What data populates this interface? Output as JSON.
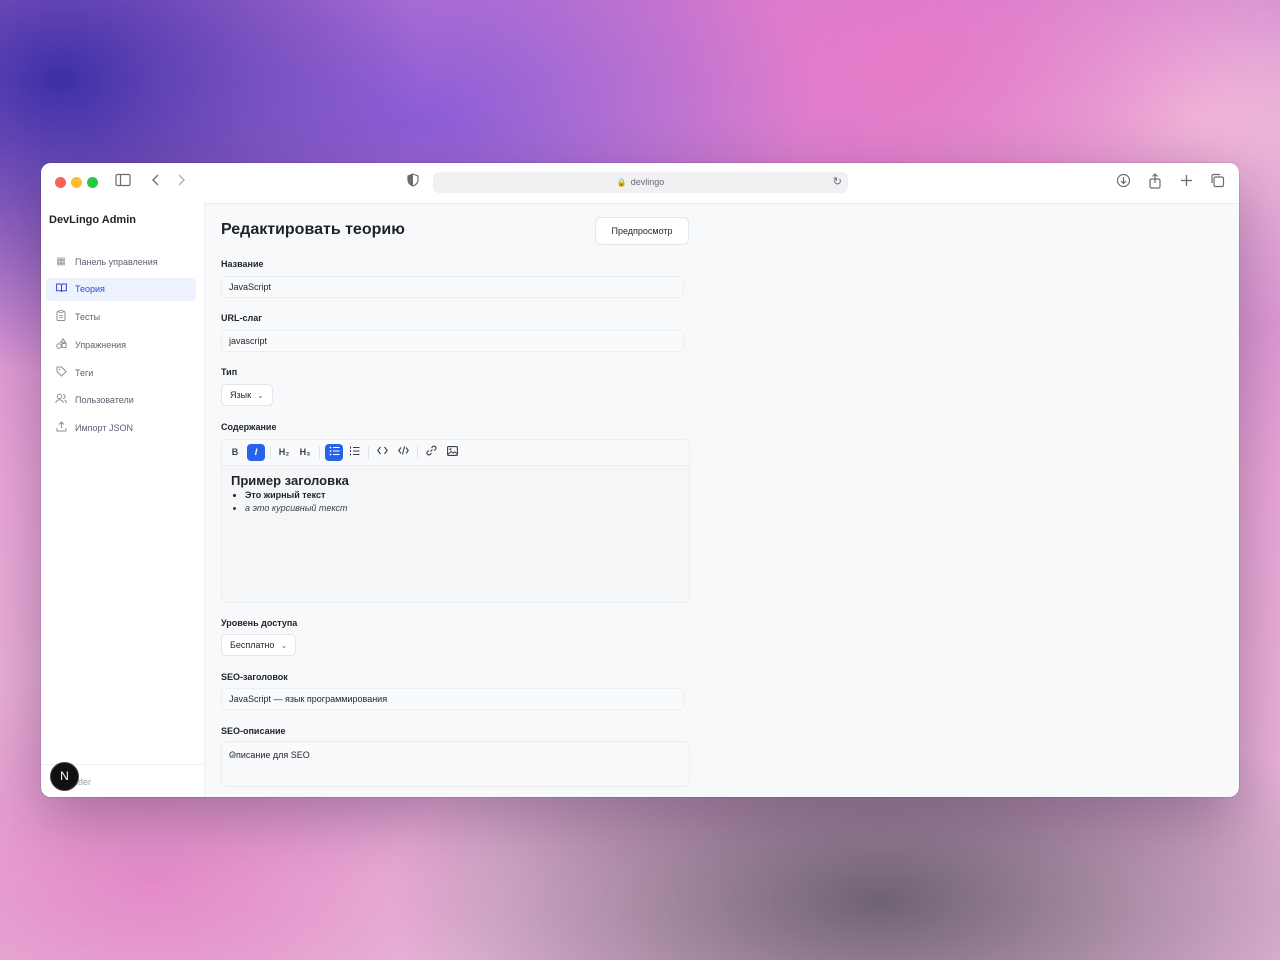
{
  "browser": {
    "url": "devlingo",
    "icons": {
      "sidebar": "sidebar-toggle-icon",
      "back": "chevron-left-icon",
      "forward": "chevron-right-icon",
      "shield": "shield-icon",
      "lock": "lock-icon",
      "reload": "reload-icon",
      "download": "download-icon",
      "share": "share-icon",
      "new_tab": "plus-icon",
      "tabs": "tabs-icon"
    }
  },
  "sidebar": {
    "brand": "DevLingo Admin",
    "items": [
      {
        "label": "Панель управления",
        "icon": "dashboard-icon",
        "active": false
      },
      {
        "label": "Теория",
        "icon": "book-icon",
        "active": true
      },
      {
        "label": "Тесты",
        "icon": "clipboard-icon",
        "active": false
      },
      {
        "label": "Упражнения",
        "icon": "shapes-icon",
        "active": false
      },
      {
        "label": "Теги",
        "icon": "tag-icon",
        "active": false
      },
      {
        "label": "Пользователи",
        "icon": "users-icon",
        "active": false
      },
      {
        "label": "Импорт JSON",
        "icon": "upload-icon",
        "active": false
      }
    ],
    "footer_text": "nder",
    "badge_letter": "N"
  },
  "main": {
    "title": "Редактировать теорию",
    "preview_label": "Предпросмотр",
    "name_label": "Название",
    "name_value": "JavaScript",
    "slug_label": "URL-слаг",
    "slug_value": "javascript",
    "type_label": "Тип",
    "type_value": "Язык",
    "content_label": "Содержание",
    "editor": {
      "toolbar": [
        "B",
        "I",
        "H₂",
        "H₃",
        "bullet-list-icon",
        "ordered-list-icon",
        "code-icon",
        "code-block-icon",
        "link-icon",
        "image-icon"
      ],
      "active": [
        "I",
        "bullet-list-icon"
      ],
      "heading": "Пример заголовка",
      "bullet_bold": "Это жирный текст",
      "bullet_italic": "а это курсивный текст"
    },
    "access_label": "Уровень доступа",
    "access_value": "Бесплатно",
    "seo_title_label": "SEO-заголовок",
    "seo_title_value": "JavaScript — язык программирования",
    "seo_desc_label": "SEO-описание",
    "seo_desc_value": "Описание для SEO"
  }
}
